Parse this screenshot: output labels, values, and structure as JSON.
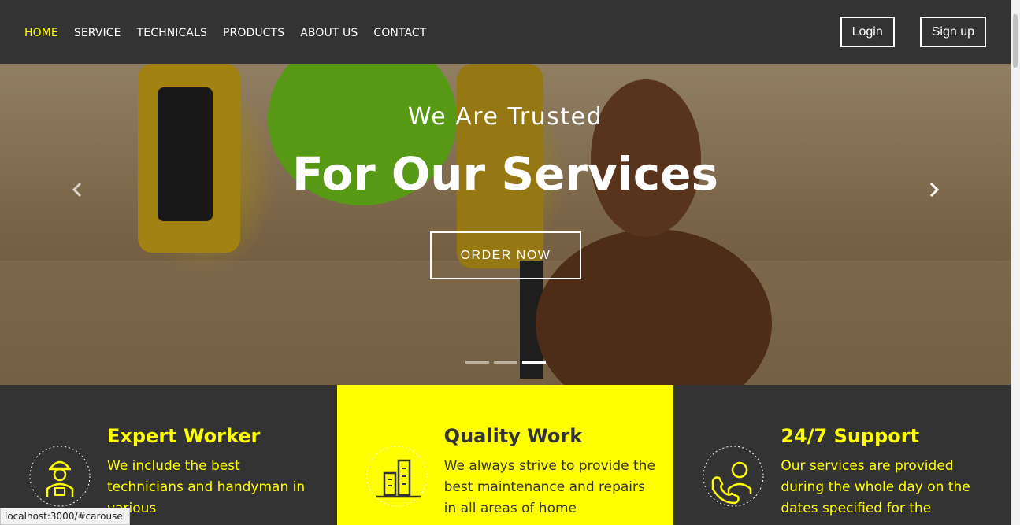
{
  "nav": {
    "links": [
      {
        "label": "HOME",
        "active": true
      },
      {
        "label": "SERVICE",
        "active": false
      },
      {
        "label": "TECHNICALS",
        "active": false
      },
      {
        "label": "PRODUCTS",
        "active": false
      },
      {
        "label": "ABOUT US",
        "active": false
      },
      {
        "label": "CONTACT",
        "active": false
      }
    ],
    "login_label": "Login",
    "signup_label": "Sign up"
  },
  "hero": {
    "subtitle": "We Are Trusted",
    "title": "For Our Services",
    "cta_label": "ORDER NOW",
    "slide_count": 3,
    "active_slide": 3
  },
  "features": [
    {
      "title": "Expert Worker",
      "text": "We include the best technicians and handyman in various",
      "icon": "worker-icon",
      "highlight": false
    },
    {
      "title": "Quality Work",
      "text": "We always strive to provide the best maintenance and repairs in all areas of home",
      "icon": "buildings-icon",
      "highlight": true
    },
    {
      "title": "24/7 Support",
      "text": "Our services are provided during the whole day on the dates specified for the",
      "icon": "support-agent-icon",
      "highlight": false
    }
  ],
  "status": {
    "url": "localhost:3000/#carousel"
  },
  "colors": {
    "accent": "#ffff00",
    "dark": "#333333",
    "white": "#ffffff"
  }
}
